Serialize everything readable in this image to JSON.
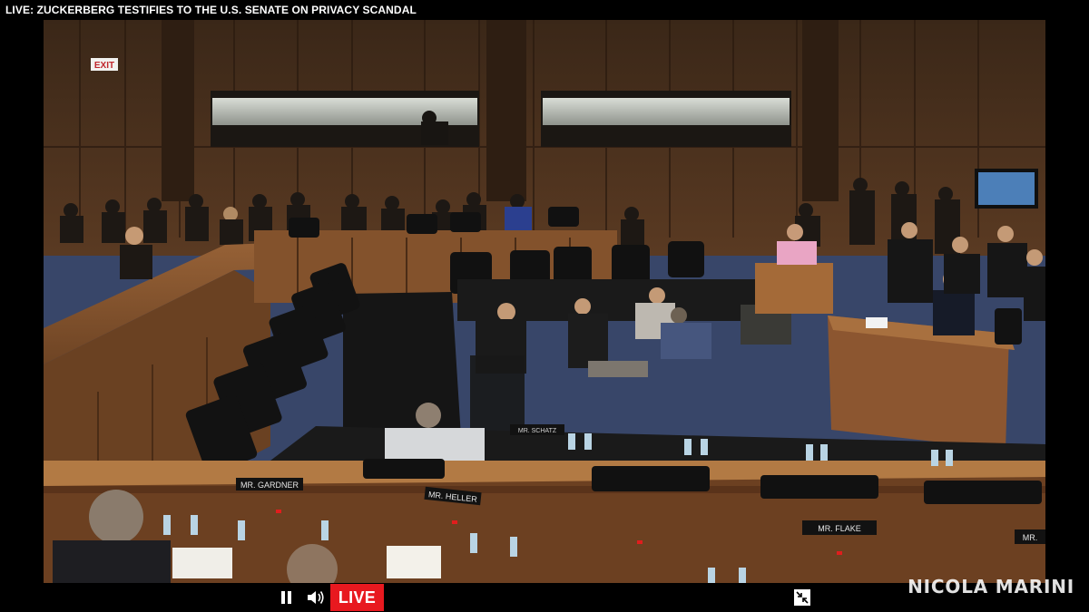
{
  "header": {
    "headline": "LIVE: ZUCKERBERG TESTIFIES TO THE U.S. SENATE ON PRIVACY SCANDAL"
  },
  "video": {
    "signs": {
      "exit": "EXIT"
    },
    "nameplates": {
      "gardner": "MR. GARDNER",
      "heller": "MR. HELLER",
      "flake": "MR. FLAKE",
      "schatz": "MR. SCHATZ",
      "right_edge": "MR."
    }
  },
  "controls": {
    "live_label": "LIVE",
    "colors": {
      "live": "#e8191f",
      "icons": "#ffffff"
    },
    "icons": {
      "pause": "pause-icon",
      "volume": "volume-icon",
      "fullscreen": "exit-fullscreen-icon"
    }
  },
  "watermark": {
    "text": "NICOLA MARINI"
  }
}
